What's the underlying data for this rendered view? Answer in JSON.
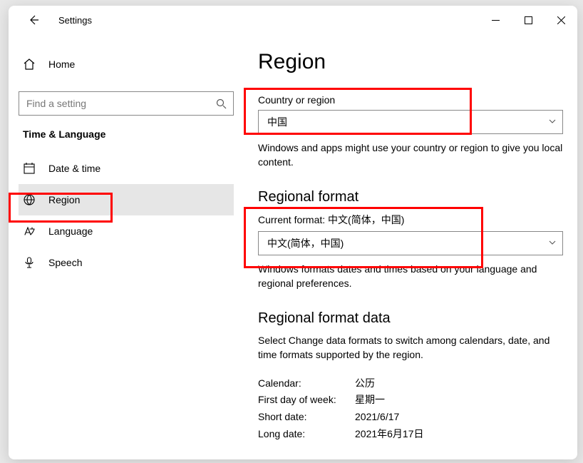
{
  "window": {
    "title": "Settings"
  },
  "sidebar": {
    "home": "Home",
    "search_placeholder": "Find a setting",
    "section": "Time & Language",
    "items": [
      {
        "label": "Date & time"
      },
      {
        "label": "Region"
      },
      {
        "label": "Language"
      },
      {
        "label": "Speech"
      }
    ]
  },
  "content": {
    "page_title": "Region",
    "country": {
      "label": "Country or region",
      "value": "中国",
      "desc": "Windows and apps might use your country or region to give you local content."
    },
    "format": {
      "heading": "Regional format",
      "current_label_prefix": "Current format: ",
      "current_value": "中文(简体，中国)",
      "dropdown_value": "中文(简体，中国)",
      "desc": "Windows formats dates and times based on your language and regional preferences."
    },
    "format_data": {
      "heading": "Regional format data",
      "desc": "Select Change data formats to switch among calendars, date, and time formats supported by the region.",
      "rows": [
        {
          "k": "Calendar:",
          "v": "公历"
        },
        {
          "k": "First day of week:",
          "v": "星期一"
        },
        {
          "k": "Short date:",
          "v": "2021/6/17"
        },
        {
          "k": "Long date:",
          "v": "2021年6月17日"
        }
      ]
    }
  }
}
